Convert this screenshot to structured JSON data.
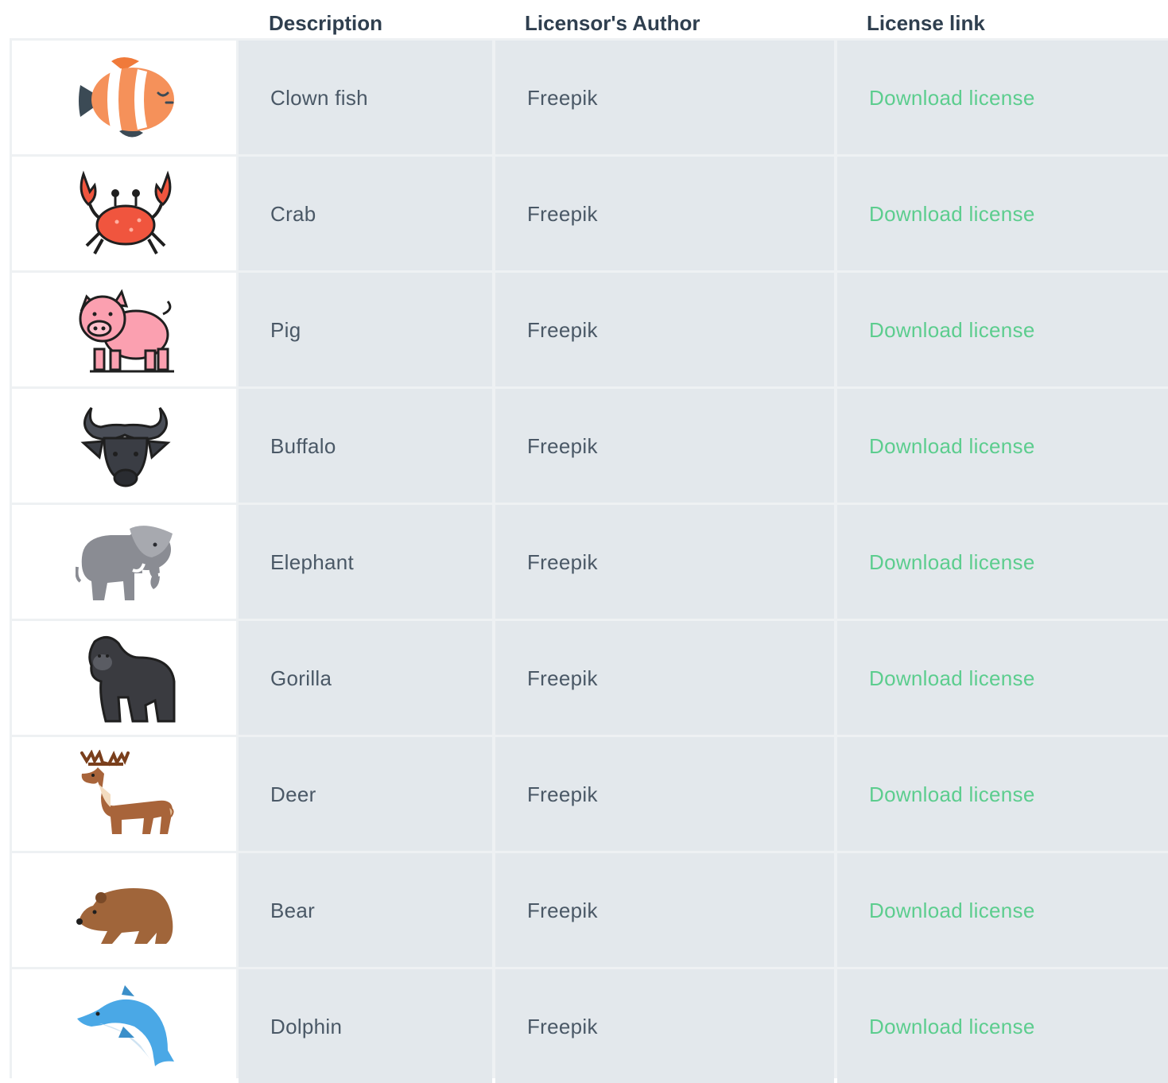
{
  "header": {
    "description": "Description",
    "author": "Licensor's Author",
    "license": "License link"
  },
  "rows": [
    {
      "icon": "clownfish-icon",
      "description": "Clown fish",
      "author": "Freepik",
      "link": "Download license"
    },
    {
      "icon": "crab-icon",
      "description": "Crab",
      "author": "Freepik",
      "link": "Download license"
    },
    {
      "icon": "pig-icon",
      "description": "Pig",
      "author": "Freepik",
      "link": "Download license"
    },
    {
      "icon": "buffalo-icon",
      "description": "Buffalo",
      "author": "Freepik",
      "link": "Download license"
    },
    {
      "icon": "elephant-icon",
      "description": "Elephant",
      "author": "Freepik",
      "link": "Download license"
    },
    {
      "icon": "gorilla-icon",
      "description": "Gorilla",
      "author": "Freepik",
      "link": "Download license"
    },
    {
      "icon": "deer-icon",
      "description": "Deer",
      "author": "Freepik",
      "link": "Download license"
    },
    {
      "icon": "bear-icon",
      "description": "Bear",
      "author": "Freepik",
      "link": "Download license"
    },
    {
      "icon": "dolphin-icon",
      "description": "Dolphin",
      "author": "Freepik",
      "link": "Download license"
    }
  ],
  "colors": {
    "link": "#5ccd8e",
    "cell_bg": "#e3e8ec",
    "header_text": "#2f3f4f",
    "body_text": "#4a5866"
  }
}
